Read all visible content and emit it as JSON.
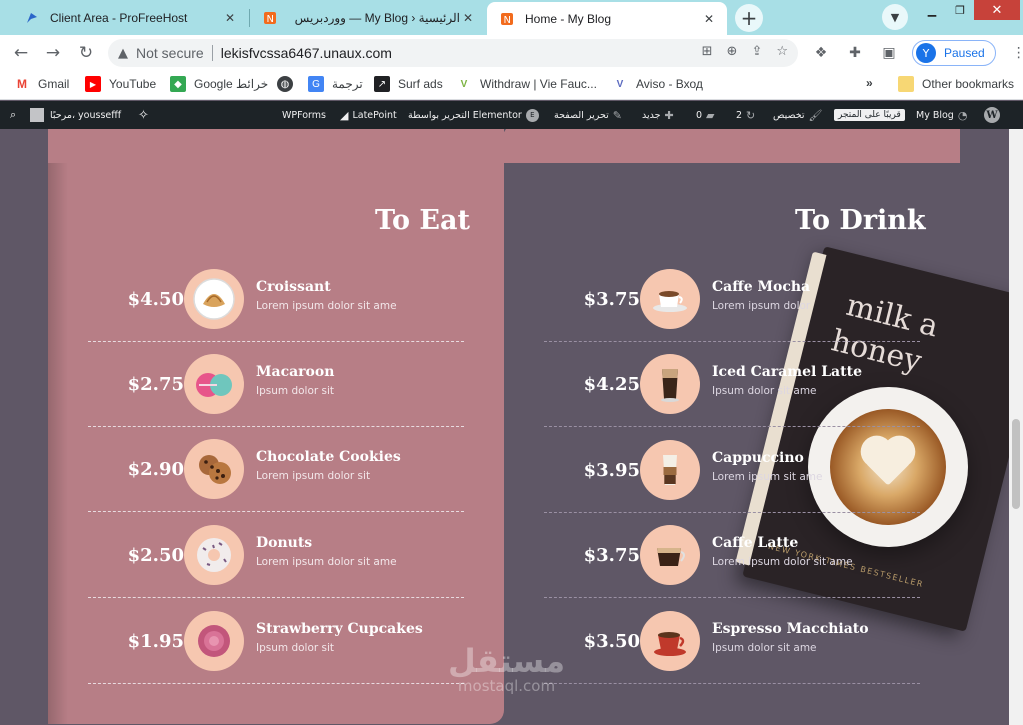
{
  "browser": {
    "tabs": [
      {
        "title": "Client Area - ProFreeHost",
        "active": false
      },
      {
        "title": "الرئيسية ‹ My Blog — ووردبريس",
        "active": false
      },
      {
        "title": "Home - My Blog",
        "active": true
      }
    ],
    "close_glyph": "✕",
    "new_tab_glyph": "+",
    "address": {
      "security_label": "Not secure",
      "url": "lekisfvcssa6467.unaux.com"
    },
    "profile": {
      "initial": "Y",
      "label": "Paused"
    },
    "bookmarks": [
      {
        "label": "Gmail",
        "icon": "gmail-icon",
        "color": "#ea4335"
      },
      {
        "label": "YouTube",
        "icon": "youtube-icon",
        "color": "#ff0000"
      },
      {
        "label": "Google خرائط",
        "icon": "maps-icon",
        "color": "#34a853"
      },
      {
        "label": "",
        "icon": "globe-icon",
        "color": "#3c4043"
      },
      {
        "label": "ترجمة",
        "icon": "translate-icon",
        "color": "#4285f4"
      },
      {
        "label": "Surf ads",
        "icon": "surfads-icon",
        "color": "#202124"
      },
      {
        "label": "Withdraw | Vie Fauc...",
        "icon": "vie-icon",
        "color": "#7cb342"
      },
      {
        "label": "Aviso - Вход",
        "icon": "aviso-icon",
        "color": "#5c6bc0"
      }
    ],
    "more_bookmarks": "»",
    "other_bookmarks": "Other bookmarks"
  },
  "wpbar": {
    "greeting": "مرحبًا، youssefff",
    "site_name": "My Blog",
    "store_chip": "قريبًا على المتجر",
    "customize": "تخصيص",
    "updates_count": "2",
    "comments_count": "0",
    "new_label": "جديد",
    "edit_page": "تحرير الصفحة",
    "edit_with_elementor": "التحرير بواسطة Elementor",
    "latepoint": "LatePoint",
    "wpforms": "WPForms"
  },
  "menu": {
    "eat": {
      "title": "To Eat",
      "items": [
        {
          "price": "$4.50",
          "name": "Croissant",
          "desc": "Lorem ipsum dolor sit ame",
          "icon": "croissant-icon"
        },
        {
          "price": "$2.75",
          "name": "Macaroon",
          "desc": "Ipsum dolor sit",
          "icon": "macaroon-icon"
        },
        {
          "price": "$2.90",
          "name": "Chocolate Cookies",
          "desc": "Lorem ipsum dolor sit",
          "icon": "cookies-icon"
        },
        {
          "price": "$2.50",
          "name": "Donuts",
          "desc": "Lorem ipsum dolor sit ame",
          "icon": "donut-icon"
        },
        {
          "price": "$1.95",
          "name": "Strawberry Cupcakes",
          "desc": "Ipsum dolor sit",
          "icon": "cupcake-icon"
        }
      ]
    },
    "drink": {
      "title": "To Drink",
      "items": [
        {
          "price": "$3.75",
          "name": "Caffe Mocha",
          "desc": "Lorem ipsum dolor",
          "icon": "mocha-icon"
        },
        {
          "price": "$4.25",
          "name": "Iced Caramel Latte",
          "desc": "Ipsum dolor sit ame",
          "icon": "iced-latte-icon"
        },
        {
          "price": "$3.95",
          "name": "Cappuccino",
          "desc": "Lorem ipsum sit ame",
          "icon": "cappuccino-icon"
        },
        {
          "price": "$3.75",
          "name": "Caffe Latte",
          "desc": "Lorem ipsum dolor sit ame",
          "icon": "latte-icon"
        },
        {
          "price": "$3.50",
          "name": "Espresso Macchiato",
          "desc": "Ipsum dolor sit ame",
          "icon": "espresso-icon"
        }
      ]
    }
  },
  "decor": {
    "book_line1": "milk a",
    "book_line2": "honey",
    "book_spine": "NEW YORK TIMES BESTSELLER"
  },
  "watermark": {
    "arabic": "مستقل",
    "latin": "mostaql.com"
  },
  "colors": {
    "tab_bar": "#a8dfe6",
    "left_panel": "#b77e86",
    "right_panel": "#5f5766",
    "icon_circle": "#f6c7b0",
    "wp_bar": "#1d2327"
  }
}
